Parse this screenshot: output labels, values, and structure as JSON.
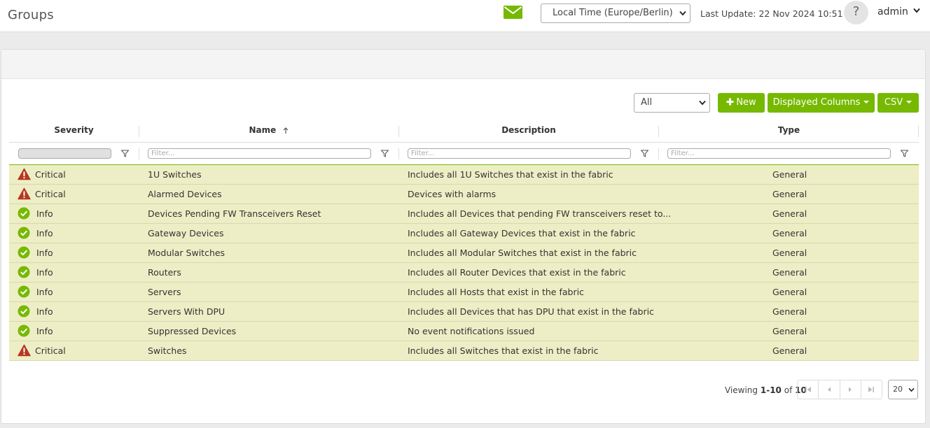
{
  "header": {
    "title": "Groups",
    "timezone": "Local Time (Europe/Berlin)",
    "last_update": "Last Update: 22 Nov 2024 10:51",
    "help_label": "?",
    "user": "admin"
  },
  "toolbar": {
    "filter_value": "All",
    "new_label": "New",
    "columns_label": "Displayed Columns",
    "csv_label": "CSV"
  },
  "columns": {
    "severity": "Severity",
    "name": "Name",
    "description": "Description",
    "type": "Type"
  },
  "filters": {
    "placeholder": "Filter..."
  },
  "rows": [
    {
      "severity": "Critical",
      "name": "1U Switches",
      "description": "Includes all 1U Switches that exist in the fabric",
      "type": "General"
    },
    {
      "severity": "Critical",
      "name": "Alarmed Devices",
      "description": "Devices with alarms",
      "type": "General"
    },
    {
      "severity": "Info",
      "name": "Devices Pending FW Transceivers Reset",
      "description": "Includes all Devices that pending FW transceivers reset to...",
      "type": "General"
    },
    {
      "severity": "Info",
      "name": "Gateway Devices",
      "description": "Includes all Gateway Devices that exist in the fabric",
      "type": "General"
    },
    {
      "severity": "Info",
      "name": "Modular Switches",
      "description": "Includes all Modular Switches that exist in the fabric",
      "type": "General"
    },
    {
      "severity": "Info",
      "name": "Routers",
      "description": "Includes all Router Devices that exist in the fabric",
      "type": "General"
    },
    {
      "severity": "Info",
      "name": "Servers",
      "description": "Includes all Hosts that exist in the fabric",
      "type": "General"
    },
    {
      "severity": "Info",
      "name": "Servers With DPU",
      "description": "Includes all Devices that has DPU that exist in the fabric",
      "type": "General"
    },
    {
      "severity": "Info",
      "name": "Suppressed Devices",
      "description": "No event notifications issued",
      "type": "General"
    },
    {
      "severity": "Critical",
      "name": "Switches",
      "description": "Includes all Switches that exist in the fabric",
      "type": "General"
    }
  ],
  "pager": {
    "viewing_label": "Viewing",
    "range": "1-10",
    "of_label": "of",
    "total": "10",
    "page_size": "20"
  },
  "colors": {
    "accent": "#76b900",
    "row_bg": "#eeeec6",
    "critical": "#b5371f",
    "info": "#76b900"
  },
  "icons": {
    "critical": "warning-triangle-icon",
    "info": "check-circle-icon"
  }
}
